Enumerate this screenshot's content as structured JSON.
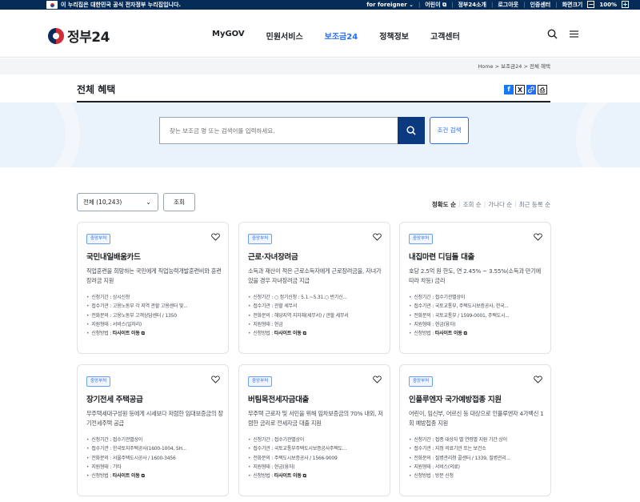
{
  "topbar": {
    "notice": "이 누리집은 대한민국 공식 전자정부 누리집입니다.",
    "links": [
      "for foreigner",
      "어린이",
      "정부24소개",
      "로그아웃",
      "인증센터",
      "화면크기"
    ],
    "zoom": "100%",
    "zoom_minus": "−",
    "zoom_plus": "+"
  },
  "header": {
    "logo_text": "정부24",
    "nav": [
      "MyGOV",
      "민원서비스",
      "보조금24",
      "정책정보",
      "고객센터"
    ],
    "active_nav": "보조금24"
  },
  "breadcrumb": {
    "items": [
      "Home",
      "보조금24",
      "전체 혜택"
    ],
    "separator": ">"
  },
  "page": {
    "title": "전체 혜택"
  },
  "share": {
    "facebook": "f",
    "x": "X",
    "print": "⎙"
  },
  "search": {
    "placeholder": "찾는 보조금 명 또는 검색어를 입력하세요.",
    "advanced_label": "조건 검색"
  },
  "filter": {
    "select_value": "전체 (10,243)",
    "button_label": "조회",
    "sort_options": [
      "정확도 순",
      "조회 순",
      "가나다 순",
      "최근 등록 순"
    ],
    "active_sort": "정확도 순"
  },
  "cards": [
    {
      "badge": "중앙부처",
      "title": "국민내일배움카드",
      "desc": "직업훈련을 희망하는 국민에게 직업능력개발훈련비와 훈련장려금 지원",
      "items": [
        {
          "label": "신청기간",
          "value": "상시신청"
        },
        {
          "label": "접수기관",
          "value": "고용노동부 각 지역 관할 고용센터 및..."
        },
        {
          "label": "전화문의",
          "value": "고용노동부 고객상담센터 / 1350"
        },
        {
          "label": "지원형태",
          "value": "서비스(일자리)"
        },
        {
          "label": "신청방법",
          "value": "타사이트 이동"
        }
      ]
    },
    {
      "badge": "중앙부처",
      "title": "근로·자녀장려금",
      "desc": "소득과 재산이 적은 근로소득자에게 근로장려금을, 자녀가 있을 경우 자녀장려금 지급",
      "items": [
        {
          "label": "신청기간",
          "value": "○ 정기신청 : 5.1.~5.31.○ 반기신..."
        },
        {
          "label": "접수기관",
          "value": "관할 세무서"
        },
        {
          "label": "전화문의",
          "value": "해당지역 지자체(세무서) / 관할 세무서"
        },
        {
          "label": "지원형태",
          "value": "현금"
        },
        {
          "label": "신청방법",
          "value": "타사이트 이동"
        }
      ]
    },
    {
      "badge": "중앙부처",
      "title": "내집마련 디딤돌 대출",
      "desc": "호당 2.5억 원 한도, 연 2.45% ~ 3.55%(소득과 만기에 따라 차등) 금리",
      "items": [
        {
          "label": "신청기간",
          "value": "접수기관별상이"
        },
        {
          "label": "접수기관",
          "value": "국토교통부, 주택도시보증공사, 한국..."
        },
        {
          "label": "전화문의",
          "value": "국토교통부 / 1599-0001, 주택도시..."
        },
        {
          "label": "지원형태",
          "value": "현금(융자)"
        },
        {
          "label": "신청방법",
          "value": "타사이트 이동"
        }
      ]
    },
    {
      "badge": "중앙부처",
      "title": "장기전세 주택공급",
      "desc": "무주택세대구성원 등에게 시세보다 저렴한 임대보증금의 장기전세주택 공급",
      "items": [
        {
          "label": "신청기간",
          "value": "접수기관별상이"
        },
        {
          "label": "접수기관",
          "value": "한국토지주택공사(1600-1004, SH..."
        },
        {
          "label": "전화문의",
          "value": "서울주택도시공사 / 1600-3456"
        },
        {
          "label": "지원형태",
          "value": "기타"
        },
        {
          "label": "신청방법",
          "value": "타사이트 이동"
        }
      ]
    },
    {
      "badge": "중앙부처",
      "title": "버팀목전세자금대출",
      "desc": "무주택 근로자 및 서민을 위해 임차보증금의 70% 내외, 저렴한 금리로 전세자금 대출 지원",
      "items": [
        {
          "label": "신청기간",
          "value": "접수기관별상이"
        },
        {
          "label": "접수기관",
          "value": "국토교통부주택도시보증공사주택도..."
        },
        {
          "label": "전화문의",
          "value": "주택도시보증공사 / 1566-9009"
        },
        {
          "label": "지원형태",
          "value": "현금(융자)"
        },
        {
          "label": "신청방법",
          "value": "타사이트 이동"
        }
      ]
    },
    {
      "badge": "중앙부처",
      "title": "인플루엔자 국가예방접종 지원",
      "desc": "어린이, 임신부, 어르신 등 대상으로 인플루엔자 4가백신 1회 예방접종 지원",
      "items": [
        {
          "label": "신청기간",
          "value": "접종 대상자 별 연령별 지원 기간 상이"
        },
        {
          "label": "접수기관",
          "value": "지정 의료기관 또는 보건소"
        },
        {
          "label": "전화문의",
          "value": "질병관리청 콜센터 / 1339, 질병관리..."
        },
        {
          "label": "지원형태",
          "value": "서비스(의료)"
        },
        {
          "label": "신청방법",
          "value": "방문 신청"
        }
      ]
    }
  ]
}
